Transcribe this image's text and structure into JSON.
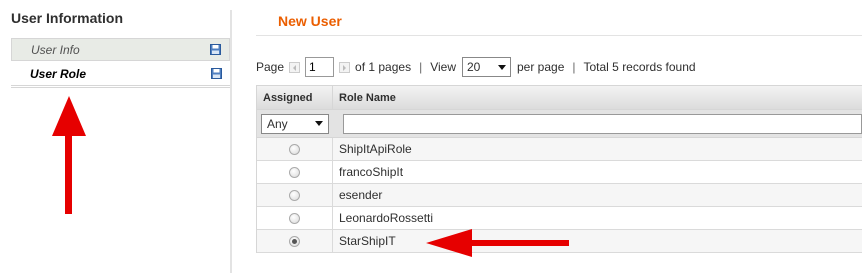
{
  "sidebar": {
    "title": "User Information",
    "tabs": [
      {
        "label": "User Info",
        "active": false
      },
      {
        "label": "User Role",
        "active": true
      }
    ]
  },
  "main": {
    "title": "New User"
  },
  "pager": {
    "page_label": "Page",
    "page_value": "1",
    "of_pages": "of 1 pages",
    "view_label": "View",
    "per_page_value": "20",
    "per_page_label": "per page",
    "total": "Total 5 records found"
  },
  "grid": {
    "columns": [
      "Assigned",
      "Role Name"
    ],
    "filter": {
      "assigned_value": "Any",
      "role_name_value": ""
    },
    "rows": [
      {
        "role_name": "ShipItApiRole",
        "assigned": false
      },
      {
        "role_name": "francoShipIt",
        "assigned": false
      },
      {
        "role_name": "esender",
        "assigned": false
      },
      {
        "role_name": "LeonardoRossetti",
        "assigned": false
      },
      {
        "role_name": "StarShipIT",
        "assigned": true
      }
    ]
  },
  "colors": {
    "title_orange": "#eb5e00",
    "annotation_red": "#e60000"
  },
  "icons": {
    "tab_icon": "save-disk-icon",
    "annotation": "red-arrow-icon"
  }
}
